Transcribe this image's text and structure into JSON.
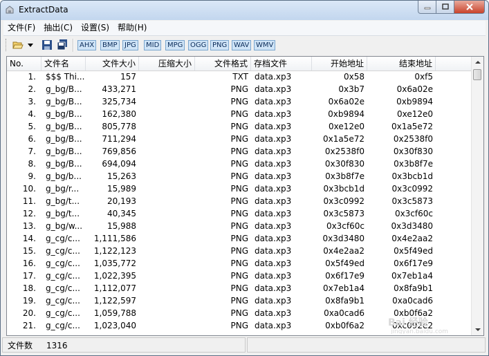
{
  "window": {
    "title": "ExtractData"
  },
  "menu": [
    "文件(F)",
    "抽出(C)",
    "设置(S)",
    "帮助(H)"
  ],
  "toolbar": {
    "formats": [
      "AHX",
      "BMP",
      "JPG",
      "MID",
      "MPG",
      "OGG",
      "PNG",
      "WAV",
      "WMV"
    ]
  },
  "columns": [
    "No.",
    "文件名",
    "文件大小",
    "压缩大小",
    "文件格式",
    "存档文件",
    "开始地址",
    "结束地址"
  ],
  "rows": [
    [
      "1.",
      "$$$ Thi...",
      "157",
      "",
      "TXT",
      "data.xp3",
      "0x58",
      "0xf5"
    ],
    [
      "2.",
      "g_bg/B...",
      "433,271",
      "",
      "PNG",
      "data.xp3",
      "0x3b7",
      "0x6a02e"
    ],
    [
      "3.",
      "g_bg/B...",
      "325,734",
      "",
      "PNG",
      "data.xp3",
      "0x6a02e",
      "0xb9894"
    ],
    [
      "4.",
      "g_bg/B...",
      "162,380",
      "",
      "PNG",
      "data.xp3",
      "0xb9894",
      "0xe12e0"
    ],
    [
      "5.",
      "g_bg/B...",
      "805,778",
      "",
      "PNG",
      "data.xp3",
      "0xe12e0",
      "0x1a5e72"
    ],
    [
      "6.",
      "g_bg/B...",
      "711,294",
      "",
      "PNG",
      "data.xp3",
      "0x1a5e72",
      "0x2538f0"
    ],
    [
      "7.",
      "g_bg/B...",
      "769,856",
      "",
      "PNG",
      "data.xp3",
      "0x2538f0",
      "0x30f830"
    ],
    [
      "8.",
      "g_bg/B...",
      "694,094",
      "",
      "PNG",
      "data.xp3",
      "0x30f830",
      "0x3b8f7e"
    ],
    [
      "9.",
      "g_bg/b...",
      "15,263",
      "",
      "PNG",
      "data.xp3",
      "0x3b8f7e",
      "0x3bcb1d"
    ],
    [
      "10.",
      "g_bg/r...",
      "15,989",
      "",
      "PNG",
      "data.xp3",
      "0x3bcb1d",
      "0x3c0992"
    ],
    [
      "11.",
      "g_bg/t...",
      "20,193",
      "",
      "PNG",
      "data.xp3",
      "0x3c0992",
      "0x3c5873"
    ],
    [
      "12.",
      "g_bg/t...",
      "40,345",
      "",
      "PNG",
      "data.xp3",
      "0x3c5873",
      "0x3cf60c"
    ],
    [
      "13.",
      "g_bg/w...",
      "15,988",
      "",
      "PNG",
      "data.xp3",
      "0x3cf60c",
      "0x3d3480"
    ],
    [
      "14.",
      "g_cg/c...",
      "1,111,586",
      "",
      "PNG",
      "data.xp3",
      "0x3d3480",
      "0x4e2aa2"
    ],
    [
      "15.",
      "g_cg/c...",
      "1,122,123",
      "",
      "PNG",
      "data.xp3",
      "0x4e2aa2",
      "0x5f49ed"
    ],
    [
      "16.",
      "g_cg/c...",
      "1,035,772",
      "",
      "PNG",
      "data.xp3",
      "0x5f49ed",
      "0x6f17e9"
    ],
    [
      "17.",
      "g_cg/c...",
      "1,022,395",
      "",
      "PNG",
      "data.xp3",
      "0x6f17e9",
      "0x7eb1a4"
    ],
    [
      "18.",
      "g_cg/c...",
      "1,112,077",
      "",
      "PNG",
      "data.xp3",
      "0x7eb1a4",
      "0x8fa9b1"
    ],
    [
      "19.",
      "g_cg/c...",
      "1,122,597",
      "",
      "PNG",
      "data.xp3",
      "0x8fa9b1",
      "0xa0cad6"
    ],
    [
      "20.",
      "g_cg/c...",
      "1,059,788",
      "",
      "PNG",
      "data.xp3",
      "0xa0cad6",
      "0xb0f6a2"
    ],
    [
      "21.",
      "g_cg/c...",
      "1,023,040",
      "",
      "PNG",
      "data.xp3",
      "0xb0f6a2",
      "0xc092e2"
    ]
  ],
  "status": {
    "label": "文件数",
    "count": "1316"
  },
  "watermark": {
    "text": "Bai 经验",
    "sub": "jingyan.baidu.com"
  }
}
